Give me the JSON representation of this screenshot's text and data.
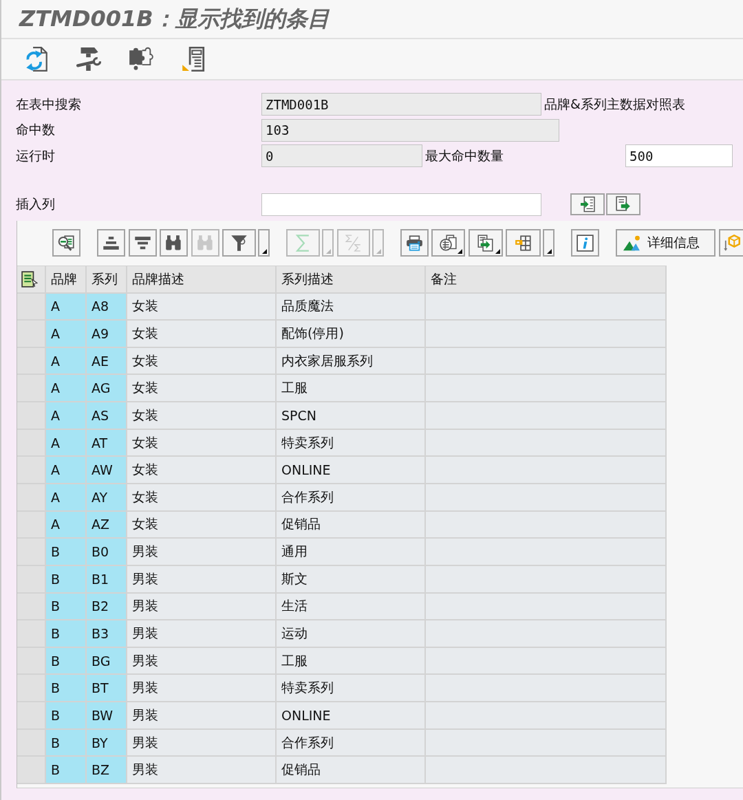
{
  "window": {
    "title": "ZTMD001B：显示找到的条目"
  },
  "toolbar": [
    {
      "kind": "refresh"
    },
    {
      "kind": "tools"
    },
    {
      "kind": "puzzle"
    },
    {
      "kind": "document"
    }
  ],
  "form": {
    "table": {
      "label": "在表中搜索",
      "value": "ZTMD001B",
      "readonly": true,
      "description": "品牌&系列主数据对照表"
    },
    "hits": {
      "label": "命中数",
      "value": "103",
      "readonly": true
    },
    "runtime": {
      "label": "运行时",
      "value": "0",
      "readonly": true
    },
    "max_hits": {
      "label": "最大命中数量",
      "value": "500",
      "readonly": false
    },
    "insert_column": {
      "label": "插入列",
      "readonly": false,
      "buttons": [
        {
          "kind": "arrow-in"
        },
        {
          "kind": "arrow-out"
        }
      ]
    }
  },
  "alv_toolbar": {
    "groups": [
      {
        "buttons": [
          {
            "kind": "detail",
            "disabled": false,
            "split_menu": false,
            "corner_menu": false
          }
        ]
      },
      {
        "buttons": [
          {
            "kind": "sort-ascending",
            "disabled": false,
            "split_menu": false,
            "corner_menu": false
          },
          {
            "kind": "sort-descending",
            "disabled": false,
            "split_menu": false,
            "corner_menu": false
          },
          {
            "kind": "find",
            "disabled": false,
            "split_menu": false,
            "corner_menu": false
          },
          {
            "kind": "find-next",
            "disabled": true,
            "split_menu": false,
            "corner_menu": false
          },
          {
            "kind": "filter",
            "disabled": false,
            "split_menu": true,
            "corner_menu": false
          }
        ]
      },
      {
        "buttons": [
          {
            "kind": "sum",
            "disabled": true,
            "split_menu": true,
            "corner_menu": false
          },
          {
            "kind": "subtotal",
            "disabled": true,
            "split_menu": true,
            "corner_menu": false
          }
        ]
      },
      {
        "buttons": [
          {
            "kind": "print",
            "disabled": false,
            "split_menu": false,
            "corner_menu": false
          },
          {
            "kind": "views",
            "disabled": false,
            "split_menu": false,
            "corner_menu": true
          },
          {
            "kind": "export",
            "disabled": false,
            "split_menu": false,
            "corner_menu": true
          },
          {
            "kind": "layout",
            "disabled": false,
            "split_menu": true,
            "corner_menu": false
          }
        ]
      },
      {
        "buttons": [
          {
            "kind": "info",
            "disabled": false,
            "split_menu": false,
            "corner_menu": false
          }
        ]
      },
      {
        "buttons": [
          {
            "kind": "details",
            "label": "详细信息",
            "disabled": false,
            "split_menu": false,
            "corner_menu": false
          },
          {
            "kind": "arrow-hexagon",
            "disabled": false,
            "split_menu": false,
            "corner_menu": false
          }
        ]
      }
    ]
  },
  "table": {
    "columns": [
      {
        "label": "品牌",
        "key": true
      },
      {
        "label": "系列",
        "key": true
      },
      {
        "label": "品牌描述",
        "key": false
      },
      {
        "label": "系列描述",
        "key": false
      },
      {
        "label": "备注",
        "key": false
      }
    ],
    "rows": [
      [
        "A",
        "A8",
        "女装",
        "品质魔法"
      ],
      [
        "A",
        "A9",
        "女装",
        "配饰(停用)"
      ],
      [
        "A",
        "AE",
        "女装",
        "内衣家居服系列"
      ],
      [
        "A",
        "AG",
        "女装",
        "工服"
      ],
      [
        "A",
        "AS",
        "女装",
        "SPCN"
      ],
      [
        "A",
        "AT",
        "女装",
        "特卖系列"
      ],
      [
        "A",
        "AW",
        "女装",
        "ONLINE"
      ],
      [
        "A",
        "AY",
        "女装",
        "合作系列"
      ],
      [
        "A",
        "AZ",
        "女装",
        "促销品"
      ],
      [
        "B",
        "B0",
        "男装",
        "通用"
      ],
      [
        "B",
        "B1",
        "男装",
        "斯文"
      ],
      [
        "B",
        "B2",
        "男装",
        "生活"
      ],
      [
        "B",
        "B3",
        "男装",
        "运动"
      ],
      [
        "B",
        "BG",
        "男装",
        "工服"
      ],
      [
        "B",
        "BT",
        "男装",
        "特卖系列"
      ],
      [
        "B",
        "BW",
        "男装",
        "ONLINE"
      ],
      [
        "B",
        "BY",
        "男装",
        "合作系列"
      ],
      [
        "B",
        "BZ",
        "男装",
        "促销品"
      ]
    ]
  }
}
